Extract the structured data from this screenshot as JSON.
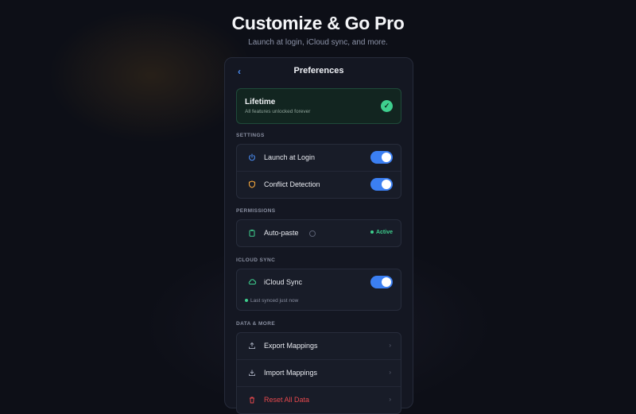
{
  "hero": {
    "title": "Customize & Go Pro",
    "subtitle": "Launch at login, iCloud sync, and more."
  },
  "panel": {
    "back_icon": "chevron-left-icon",
    "title": "Preferences"
  },
  "lifetime": {
    "title": "Lifetime",
    "subtitle": "All features unlocked forever",
    "icon": "check-circle-icon"
  },
  "settings": {
    "label": "SETTINGS",
    "items": [
      {
        "label": "Launch at Login",
        "icon": "power-icon",
        "enabled": true,
        "color": "#4a8bf0"
      },
      {
        "label": "Conflict Detection",
        "icon": "shield-icon",
        "enabled": true,
        "color": "#f0a43c"
      }
    ]
  },
  "permissions": {
    "label": "PERMISSIONS",
    "items": [
      {
        "label": "Auto-paste",
        "icon": "clipboard-icon",
        "status": "Active",
        "color": "#3ecf8e"
      }
    ]
  },
  "icloud": {
    "label": "ICLOUD SYNC",
    "item": {
      "label": "iCloud Sync",
      "icon": "cloud-icon",
      "enabled": true
    },
    "status": "Last synced just now"
  },
  "data_more": {
    "label": "DATA & MORE",
    "items": [
      {
        "label": "Export Mappings",
        "icon": "upload-icon"
      },
      {
        "label": "Import Mappings",
        "icon": "download-icon"
      },
      {
        "label": "Reset All Data",
        "icon": "trash-icon",
        "color": "#e5484d"
      }
    ]
  },
  "colors": {
    "accent": "#3b7ff2",
    "success": "#3ecf8e",
    "danger": "#e5484d"
  }
}
